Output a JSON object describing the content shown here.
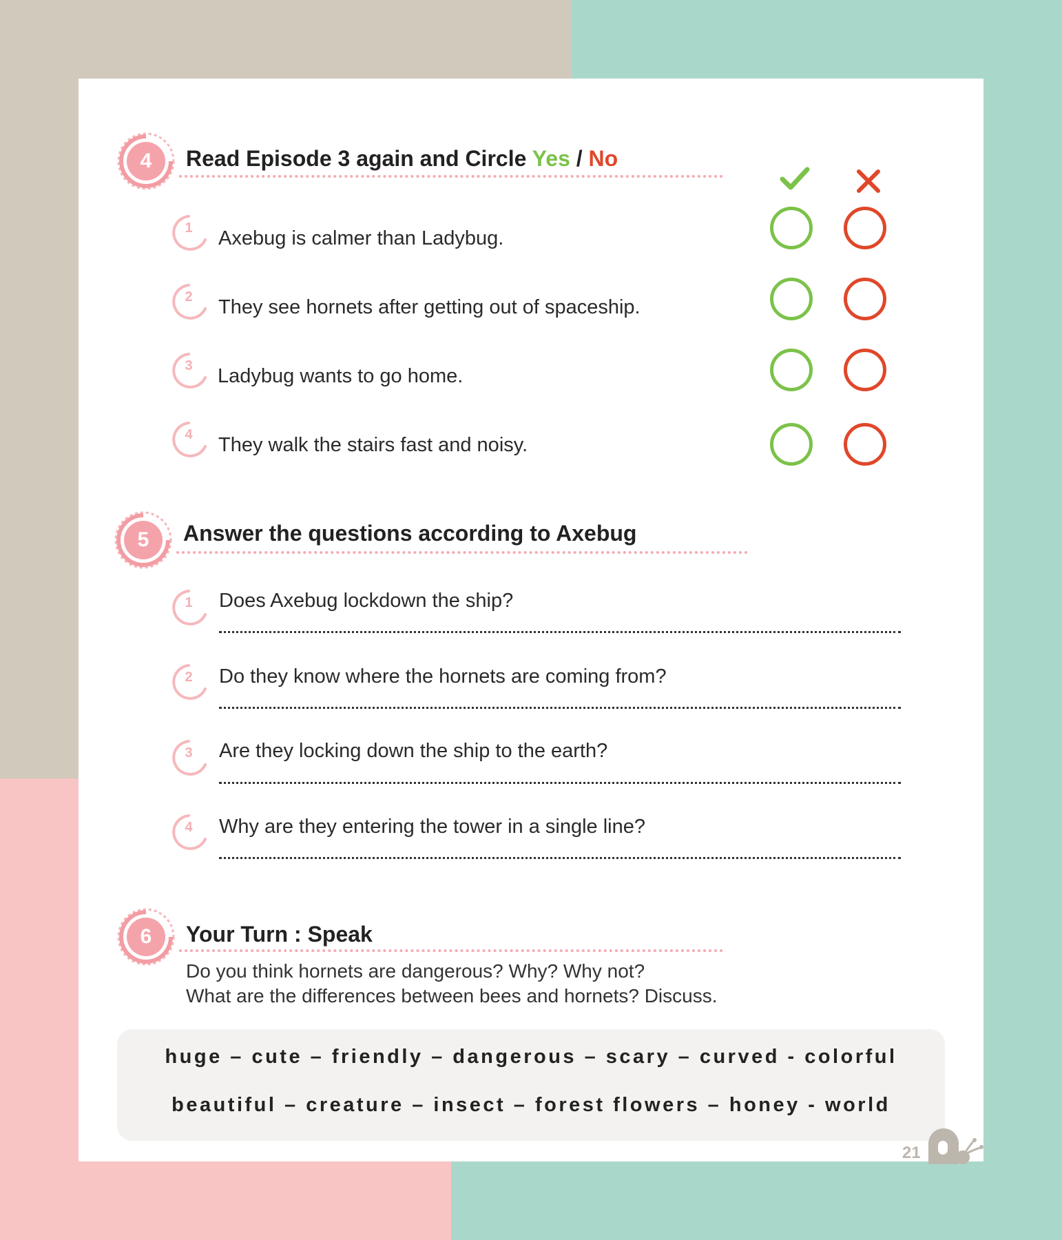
{
  "section4": {
    "number": "4",
    "title_prefix": "Read Episode 3 again and Circle ",
    "yes_label": "Yes",
    "slash": " / ",
    "no_label": "No",
    "items": [
      {
        "number": "1",
        "text": "Axebug is calmer than Ladybug."
      },
      {
        "number": "2",
        "text": "They see hornets after getting out of spaceship."
      },
      {
        "number": "3",
        "text": "Ladybug wants to go home."
      },
      {
        "number": "4",
        "text": "They walk the stairs fast and noisy."
      }
    ],
    "check_icon": "check-icon",
    "cross_icon": "cross-icon",
    "yes_color": "#7cc24a",
    "no_color": "#e0472a"
  },
  "section5": {
    "number": "5",
    "title": "Answer the questions according to Axebug",
    "items": [
      {
        "number": "1",
        "text": "Does Axebug lockdown the ship?"
      },
      {
        "number": "2",
        "text": "Do they know where the hornets are coming from?"
      },
      {
        "number": "3",
        "text": "Are they locking down the ship to the earth?"
      },
      {
        "number": "4",
        "text": "Why are they entering the tower in a single line?"
      }
    ]
  },
  "section6": {
    "number": "6",
    "title": "Your Turn : Speak",
    "prompt_line1": "Do you think hornets are dangerous? Why? Why not?",
    "prompt_line2": "What are the differences between bees and hornets? Discuss."
  },
  "word_bank": {
    "line1": "huge – cute – friendly – dangerous – scary – curved - colorful",
    "line2": "beautiful – creature – insect – forest  flowers – honey -  world"
  },
  "page_number": "21"
}
